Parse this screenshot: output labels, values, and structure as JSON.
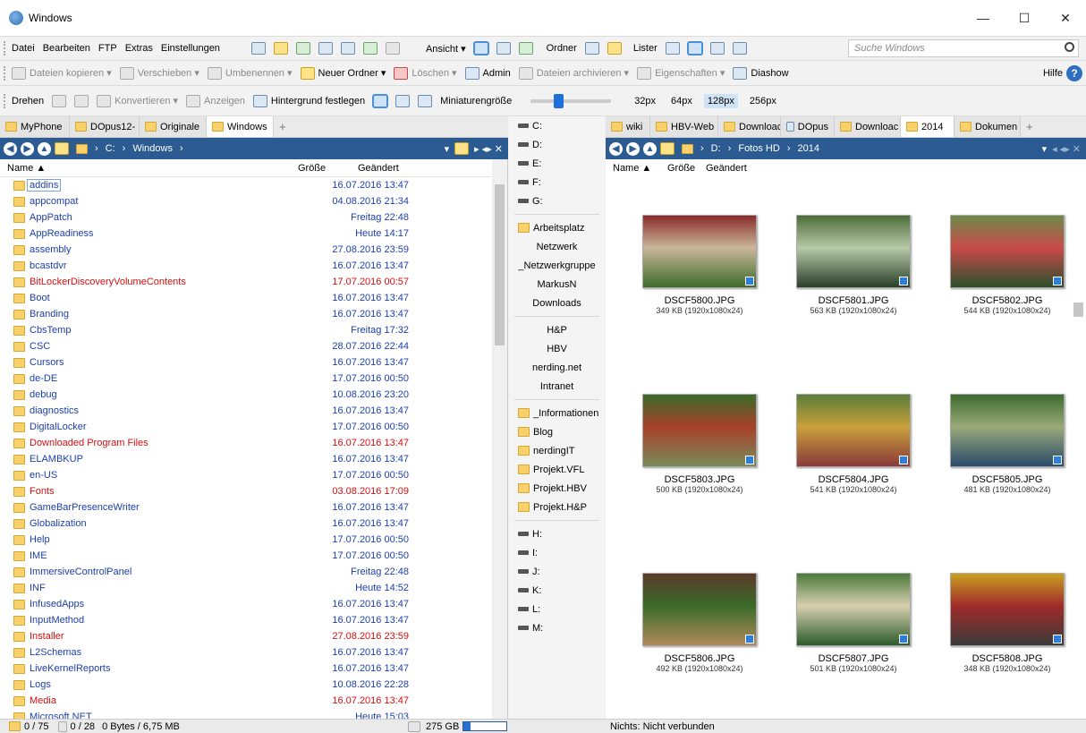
{
  "window": {
    "title": "Windows",
    "minimize": "—",
    "maximize": "☐",
    "close": "✕"
  },
  "menubar": {
    "items": [
      "Datei",
      "Bearbeiten",
      "FTP",
      "Extras",
      "Einstellungen"
    ],
    "view_label": "Ansicht ▾",
    "folder_label": "Ordner",
    "lister_label": "Lister",
    "search_placeholder": "Suche Windows"
  },
  "toolbar1": {
    "copy": "Dateien kopieren ▾",
    "move": "Verschieben ▾",
    "rename": "Umbenennen ▾",
    "new_folder": "Neuer Ordner ▾",
    "delete": "Löschen ▾",
    "admin": "Admin",
    "archive": "Dateien archivieren ▾",
    "properties": "Eigenschaften ▾",
    "slideshow": "Diashow",
    "help": "Hilfe"
  },
  "toolbar2": {
    "rotate": "Drehen",
    "convert": "Konvertieren ▾",
    "show": "Anzeigen",
    "set_bg": "Hintergrund festlegen",
    "thumb_size": "Miniaturengröße",
    "sizes": [
      "32px",
      "64px",
      "128px",
      "256px"
    ],
    "active_size": "128px"
  },
  "left": {
    "tabs": [
      "MyPhone",
      "DOpus12-",
      "Originale",
      "Windows"
    ],
    "path": [
      "C:",
      "Windows"
    ],
    "columns": {
      "name": "Name ▲",
      "size": "Größe",
      "modified": "Geändert"
    },
    "rows": [
      {
        "name": "addins",
        "date": "16.07.2016 13:47",
        "red": false,
        "sel": true
      },
      {
        "name": "appcompat",
        "date": "04.08.2016 21:34",
        "red": false
      },
      {
        "name": "AppPatch",
        "date": "Freitag 22:48",
        "red": false
      },
      {
        "name": "AppReadiness",
        "date": "Heute 14:17",
        "red": false
      },
      {
        "name": "assembly",
        "date": "27.08.2016 23:59",
        "red": false
      },
      {
        "name": "bcastdvr",
        "date": "16.07.2016 13:47",
        "red": false
      },
      {
        "name": "BitLockerDiscoveryVolumeContents",
        "date": "17.07.2016 00:57",
        "red": true
      },
      {
        "name": "Boot",
        "date": "16.07.2016 13:47",
        "red": false
      },
      {
        "name": "Branding",
        "date": "16.07.2016 13:47",
        "red": false
      },
      {
        "name": "CbsTemp",
        "date": "Freitag 17:32",
        "red": false
      },
      {
        "name": "CSC",
        "date": "28.07.2016 22:44",
        "red": false
      },
      {
        "name": "Cursors",
        "date": "16.07.2016 13:47",
        "red": false
      },
      {
        "name": "de-DE",
        "date": "17.07.2016 00:50",
        "red": false
      },
      {
        "name": "debug",
        "date": "10.08.2016 23:20",
        "red": false
      },
      {
        "name": "diagnostics",
        "date": "16.07.2016 13:47",
        "red": false
      },
      {
        "name": "DigitalLocker",
        "date": "17.07.2016 00:50",
        "red": false
      },
      {
        "name": "Downloaded Program Files",
        "date": "16.07.2016 13:47",
        "red": true
      },
      {
        "name": "ELAMBKUP",
        "date": "16.07.2016 13:47",
        "red": false
      },
      {
        "name": "en-US",
        "date": "17.07.2016 00:50",
        "red": false
      },
      {
        "name": "Fonts",
        "date": "03.08.2016 17:09",
        "red": true
      },
      {
        "name": "GameBarPresenceWriter",
        "date": "16.07.2016 13:47",
        "red": false
      },
      {
        "name": "Globalization",
        "date": "16.07.2016 13:47",
        "red": false
      },
      {
        "name": "Help",
        "date": "17.07.2016 00:50",
        "red": false
      },
      {
        "name": "IME",
        "date": "17.07.2016 00:50",
        "red": false
      },
      {
        "name": "ImmersiveControlPanel",
        "date": "Freitag 22:48",
        "red": false
      },
      {
        "name": "INF",
        "date": "Heute 14:52",
        "red": false
      },
      {
        "name": "InfusedApps",
        "date": "16.07.2016 13:47",
        "red": false
      },
      {
        "name": "InputMethod",
        "date": "16.07.2016 13:47",
        "red": false
      },
      {
        "name": "Installer",
        "date": "27.08.2016 23:59",
        "red": true
      },
      {
        "name": "L2Schemas",
        "date": "16.07.2016 13:47",
        "red": false
      },
      {
        "name": "LiveKernelReports",
        "date": "16.07.2016 13:47",
        "red": false
      },
      {
        "name": "Logs",
        "date": "10.08.2016 22:28",
        "red": false
      },
      {
        "name": "Media",
        "date": "16.07.2016 13:47",
        "red": true
      },
      {
        "name": "Microsoft.NET",
        "date": "Heute 15:03",
        "red": false
      }
    ]
  },
  "middle": {
    "drives_top": [
      "C:",
      "D:",
      "E:",
      "F:",
      "G:"
    ],
    "places": [
      "Arbeitsplatz",
      "Netzwerk",
      "_Netzwerkgruppe",
      "MarkusN",
      "Downloads"
    ],
    "network": [
      "H&P",
      "HBV",
      "nerding.net",
      "Intranet"
    ],
    "folders": [
      "_Informationen",
      "Blog",
      "nerdingIT",
      "Projekt.VFL",
      "Projekt.HBV",
      "Projekt.H&P"
    ],
    "drives_bottom": [
      "H:",
      "I:",
      "J:",
      "K:",
      "L:",
      "M:"
    ]
  },
  "right": {
    "tabs": [
      "wiki",
      "HBV-Web",
      "Downloac",
      "DOpus",
      "Downloac",
      "2014",
      "Dokumen"
    ],
    "path": [
      "D:",
      "Fotos HD",
      "2014"
    ],
    "columns": {
      "name": "Name ▲",
      "size": "Größe",
      "modified": "Geändert"
    },
    "thumbs": [
      {
        "name": "DSCF5800.JPG",
        "info": "349 KB (1920x1080x24)"
      },
      {
        "name": "DSCF5801.JPG",
        "info": "563 KB (1920x1080x24)"
      },
      {
        "name": "DSCF5802.JPG",
        "info": "544 KB (1920x1080x24)"
      },
      {
        "name": "DSCF5803.JPG",
        "info": "500 KB (1920x1080x24)"
      },
      {
        "name": "DSCF5804.JPG",
        "info": "541 KB (1920x1080x24)"
      },
      {
        "name": "DSCF5805.JPG",
        "info": "481 KB (1920x1080x24)"
      },
      {
        "name": "DSCF5806.JPG",
        "info": "492 KB (1920x1080x24)"
      },
      {
        "name": "DSCF5807.JPG",
        "info": "501 KB (1920x1080x24)"
      },
      {
        "name": "DSCF5808.JPG",
        "info": "348 KB (1920x1080x24)"
      }
    ]
  },
  "status": {
    "left_dirs": "0 / 75",
    "left_files": "0 / 28",
    "left_bytes": "0 Bytes / 6,75 MB",
    "free_space": "275 GB",
    "right_text": "Nichts: Nicht verbunden"
  }
}
